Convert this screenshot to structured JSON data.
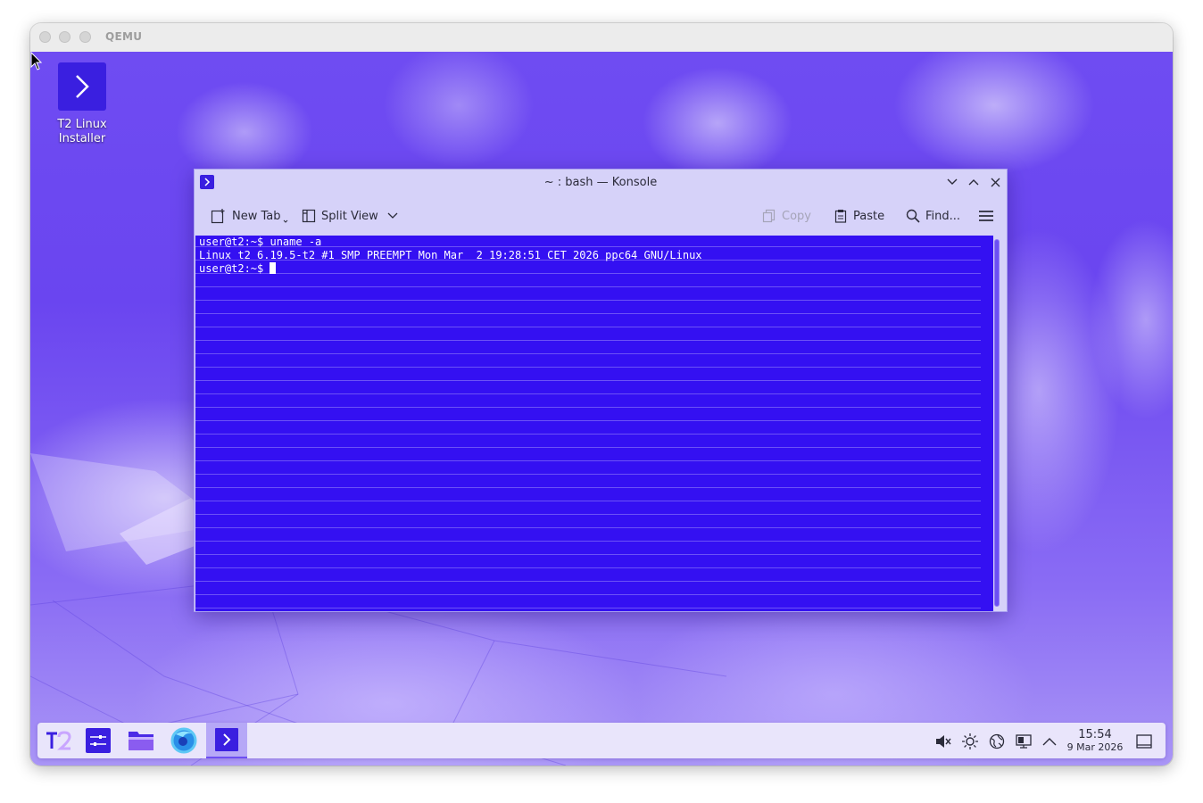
{
  "qemu": {
    "title": "QEMU"
  },
  "desktop": {
    "icons": [
      {
        "label_line1": "T2 Linux",
        "label_line2": "Installer",
        "icon": "terminal-chevron-icon"
      }
    ]
  },
  "konsole": {
    "title": "~ : bash — Konsole",
    "toolbar": {
      "new_tab": "New Tab",
      "split_view": "Split View",
      "copy": "Copy",
      "paste": "Paste",
      "find": "Find..."
    },
    "terminal": {
      "lines": [
        "user@t2:~$ uname -a",
        "Linux t2 6.19.5-t2 #1 SMP PREEMPT Mon Mar  2 19:28:51 CET 2026 ppc64 GNU/Linux",
        "user@t2:~$ "
      ]
    }
  },
  "taskbar": {
    "launchers": [
      "t2-logo-icon",
      "settings-sliders-icon",
      "folder-icon",
      "firefox-icon",
      "konsole-icon"
    ],
    "tray": [
      "muted-speaker-icon",
      "brightness-icon",
      "network-globe-icon",
      "display-icon",
      "chevron-up-icon"
    ],
    "clock": {
      "time": "15:54",
      "date": "9 Mar 2026"
    }
  },
  "colors": {
    "terminal_bg": "#3410f2",
    "accent": "#3a1fe0",
    "window_bg": "#d6d2f9"
  }
}
